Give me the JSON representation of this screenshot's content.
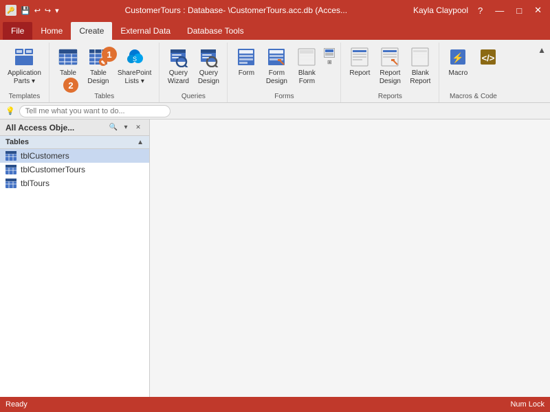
{
  "titlebar": {
    "title": "CustomerTours : Database- \\CustomerTours.acc.db (Acces...",
    "user": "Kayla Claypool",
    "help": "?",
    "minimize": "—",
    "maximize": "□",
    "close": "✕"
  },
  "qat": {
    "save": "💾",
    "undo": "↩",
    "redo": "↪",
    "dropdown": "▾"
  },
  "ribbon_tabs": [
    {
      "label": "File",
      "active": false
    },
    {
      "label": "Home",
      "active": false
    },
    {
      "label": "Create",
      "active": true
    },
    {
      "label": "External Data",
      "active": false
    },
    {
      "label": "Database Tools",
      "active": false
    }
  ],
  "ribbon_groups": [
    {
      "name": "Templates",
      "items": [
        {
          "icon": "🗂",
          "label": "Application\nParts ▾",
          "id": "app-parts"
        }
      ]
    },
    {
      "name": "Tables",
      "items": [
        {
          "icon": "📋",
          "label": "Table",
          "id": "table"
        },
        {
          "icon": "📐",
          "label": "Table\nDesign",
          "id": "table-design"
        },
        {
          "icon": "📊",
          "label": "SharePoint\nLists ▾",
          "id": "sharepoint"
        }
      ]
    },
    {
      "name": "Queries",
      "items": [
        {
          "icon": "🔍",
          "label": "Query\nWizard",
          "id": "query-wizard"
        },
        {
          "icon": "🔎",
          "label": "Query\nDesign",
          "id": "query-design"
        }
      ]
    },
    {
      "name": "Forms",
      "items": [
        {
          "icon": "📝",
          "label": "Form",
          "id": "form"
        },
        {
          "icon": "📋",
          "label": "Form\nDesign",
          "id": "form-design"
        },
        {
          "icon": "📄",
          "label": "Blank\nForm",
          "id": "blank-form"
        },
        {
          "icon": "⊞",
          "label": "",
          "id": "form-extra"
        }
      ]
    },
    {
      "name": "Reports",
      "items": [
        {
          "icon": "📊",
          "label": "Report",
          "id": "report"
        },
        {
          "icon": "📐",
          "label": "Report\nDesign",
          "id": "report-design"
        },
        {
          "icon": "📄",
          "label": "Blank\nReport",
          "id": "blank-report"
        }
      ]
    },
    {
      "name": "Macros & Code",
      "items": [
        {
          "icon": "⚙",
          "label": "Macro",
          "id": "macro"
        },
        {
          "icon": "🔧",
          "label": "",
          "id": "code-extra"
        }
      ]
    }
  ],
  "tell_me": {
    "placeholder": "Tell me what you want to do...",
    "icon": "💡"
  },
  "sidebar": {
    "title": "All Access Obje...",
    "section": "Tables",
    "items": [
      {
        "label": "tblCustomers",
        "selected": true
      },
      {
        "label": "tblCustomerTours",
        "selected": false
      },
      {
        "label": "tblTours",
        "selected": false
      }
    ]
  },
  "statusbar": {
    "left": "Ready",
    "right": "Num Lock"
  },
  "steps": {
    "step1": "1",
    "step2": "2"
  }
}
